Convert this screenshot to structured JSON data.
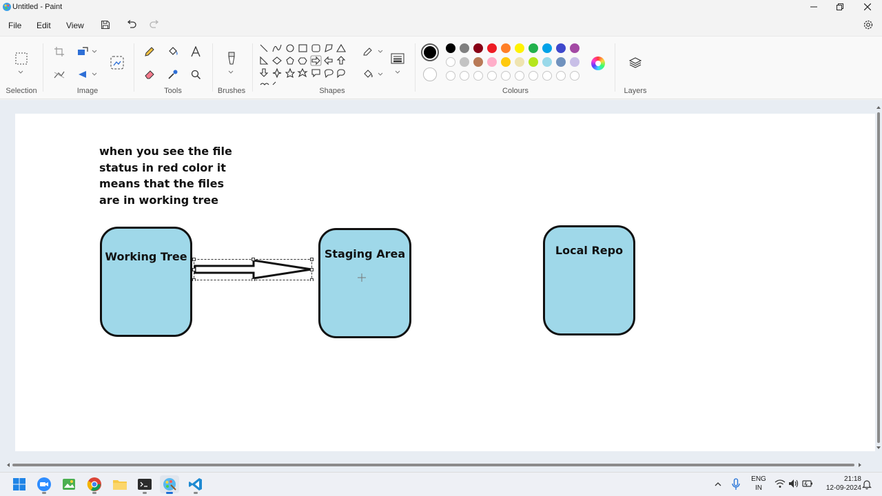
{
  "window": {
    "title": "Untitled - Paint"
  },
  "menu": {
    "file": "File",
    "edit": "Edit",
    "view": "View"
  },
  "ribbon": {
    "groups": {
      "selection": "Selection",
      "image": "Image",
      "tools": "Tools",
      "brushes": "Brushes",
      "shapes": "Shapes",
      "colours": "Colours",
      "layers": "Layers"
    },
    "active_colour": "#000000",
    "palette_row1": [
      "#000000",
      "#7f7f7f",
      "#880015",
      "#ed1c24",
      "#ff7f27",
      "#fff200",
      "#22b14c",
      "#00a2e8",
      "#3f48cc",
      "#a349a4"
    ],
    "palette_row2": [
      "#ffffff",
      "#c3c3c3",
      "#b97a57",
      "#ffaec9",
      "#ffc90e",
      "#efe4b0",
      "#b5e61d",
      "#99d9ea",
      "#7092be",
      "#c8bfe7"
    ],
    "custom_colour_slots": 10
  },
  "canvas": {
    "note": "when you see the file\nstatus in red color it\nmeans that the files\nare in working tree",
    "boxes": {
      "working_tree": "Working Tree",
      "staging_area": "Staging Area",
      "local_repo": "Local Repo"
    },
    "box_fill": "#9fd8e9"
  },
  "taskbar": {
    "lang_line1": "ENG",
    "lang_line2": "IN",
    "time": "21:18",
    "date": "12-09-2024"
  }
}
